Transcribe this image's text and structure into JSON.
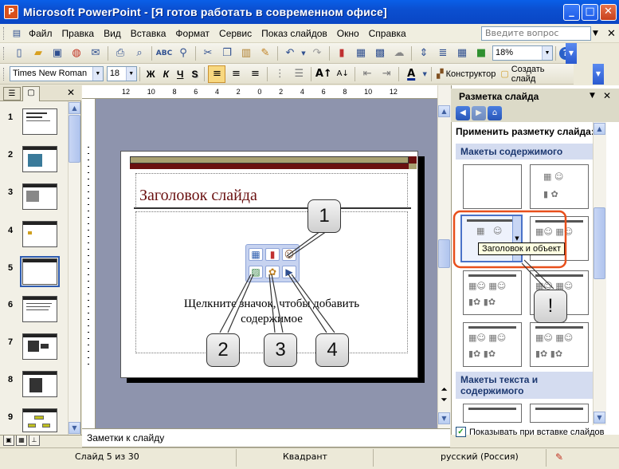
{
  "window": {
    "title": "Microsoft PowerPoint - [Я готов работать в современном офисе]",
    "app_icon": "P"
  },
  "menu": {
    "items": [
      "Файл",
      "Правка",
      "Вид",
      "Вставка",
      "Формат",
      "Сервис",
      "Показ слайдов",
      "Окно",
      "Справка"
    ],
    "help_placeholder": "Введите вопрос"
  },
  "toolbar_standard": {
    "zoom": "18%"
  },
  "toolbar_format": {
    "font_name": "Times New Roman",
    "font_size": "18",
    "bold": "Ж",
    "italic": "К",
    "underline": "Ч",
    "shadow": "S",
    "designer": "Конструктор",
    "new_slide": "Создать слайд"
  },
  "slides_panel": {
    "numbers": [
      "1",
      "2",
      "3",
      "4",
      "5",
      "6",
      "7",
      "8",
      "9"
    ],
    "selected_index": 5
  },
  "ruler": {
    "h_labels": [
      "12",
      "10",
      "8",
      "6",
      "4",
      "2",
      "0",
      "2",
      "4",
      "6",
      "8",
      "10",
      "12"
    ]
  },
  "slide": {
    "title_placeholder": "Заголовок слайда",
    "content_placeholder": "Щелкните значок, чтобы добавить содержимое"
  },
  "callouts": [
    "1",
    "2",
    "3",
    "4",
    "!"
  ],
  "task_pane": {
    "title": "Разметка слайда",
    "apply_label": "Применить разметку слайда:",
    "section_content": "Макеты содержимого",
    "section_text_content": "Макеты текста и содержимого",
    "tooltip": "Заголовок и объект",
    "show_on_insert": "Показывать при вставке слайдов",
    "show_on_insert_checked": true
  },
  "notes": {
    "placeholder": "Заметки к слайду"
  },
  "status": {
    "slide_counter": "Слайд 5 из 30",
    "design": "Квадрант",
    "language": "русский (Россия)"
  },
  "colors": {
    "titlebar": "#0a5fe8",
    "slide_accent_dark": "#6a1010",
    "slide_accent_olive": "#a8a070",
    "highlight_red": "#e8501c"
  }
}
